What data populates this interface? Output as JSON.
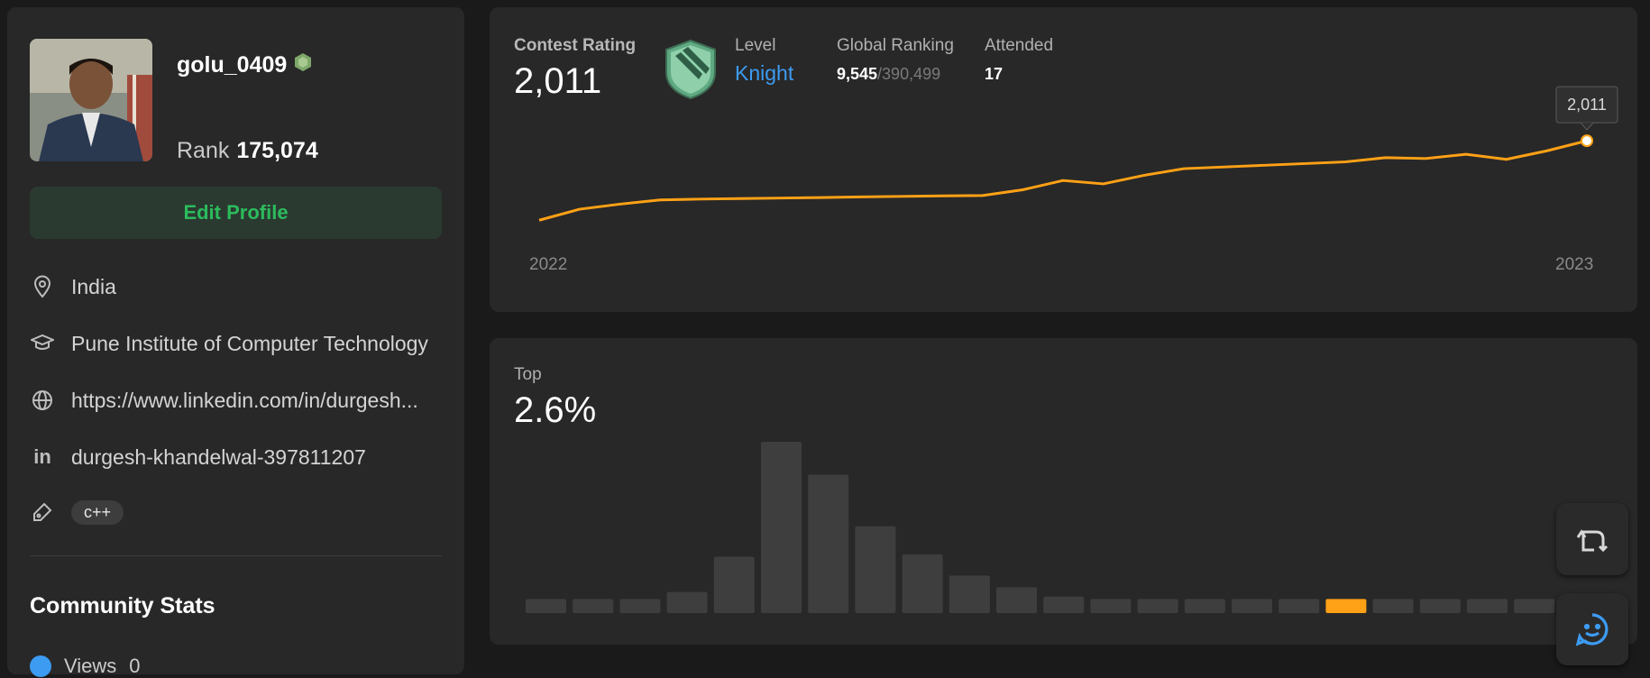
{
  "profile": {
    "username": "golu_0409",
    "rank_label": "Rank",
    "rank_value": "175,074",
    "edit_button": "Edit Profile",
    "location": "India",
    "school": "Pune Institute of Computer Technology",
    "website": "https://www.linkedin.com/in/durgesh...",
    "linkedin": "durgesh-khandelwal-397811207",
    "skill_tag": "c++",
    "community_title": "Community Stats",
    "views_label": "Views",
    "views_value": "0"
  },
  "rating": {
    "contest_rating_label": "Contest Rating",
    "contest_rating_value": "2,011",
    "level_label": "Level",
    "level_value": "Knight",
    "global_ranking_label": "Global Ranking",
    "global_ranking_value": "9,545",
    "global_ranking_total": "/390,499",
    "attended_label": "Attended",
    "attended_value": "17",
    "tooltip": "2,011",
    "year_start": "2022",
    "year_end": "2023"
  },
  "top": {
    "label": "Top",
    "value": "2.6%"
  },
  "chart_data": [
    {
      "type": "line",
      "x": [
        "2022",
        "",
        "",
        "",
        "",
        "",
        "",
        "",
        "",
        "",
        "",
        "",
        "",
        "",
        "",
        "",
        "",
        "",
        "",
        "",
        "",
        "",
        "",
        "",
        "",
        "",
        "2023"
      ],
      "values": [
        1480,
        1545,
        1575,
        1600,
        1605,
        1608,
        1611,
        1614,
        1618,
        1621,
        1624,
        1626,
        1660,
        1715,
        1695,
        1745,
        1785,
        1795,
        1805,
        1815,
        1825,
        1850,
        1845,
        1870,
        1840,
        1890,
        1950
      ],
      "highlight_last": "2,011",
      "color": "#ffa116"
    },
    {
      "type": "bar",
      "values": [
        6,
        6,
        6,
        9,
        24,
        73,
        59,
        37,
        25,
        16,
        11,
        7,
        6,
        6,
        6,
        6,
        6,
        6,
        6,
        6,
        6,
        6,
        6
      ],
      "highlight_index": 17,
      "bar_color": "#3e3e3e",
      "highlight_color": "#ffa116"
    }
  ],
  "colors": {
    "accent": "#ffa116",
    "green": "#2cbb5d",
    "blue": "#3d9bf2"
  }
}
